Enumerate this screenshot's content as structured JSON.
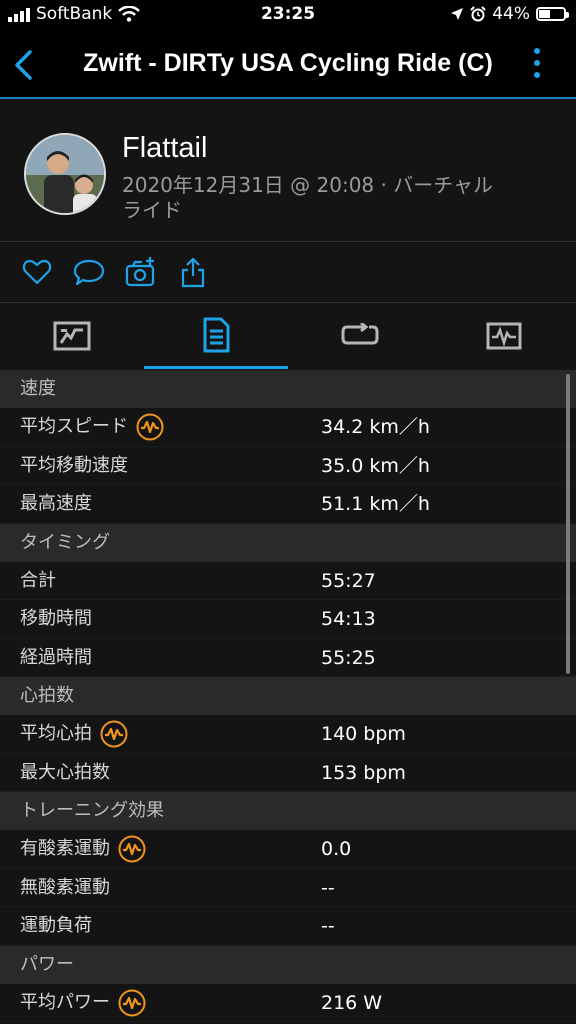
{
  "status_bar": {
    "carrier": "SoftBank",
    "time": "23:25",
    "battery_percent": "44%",
    "battery_level": 0.44,
    "icons": [
      "signal-icon",
      "wifi-icon",
      "location-icon",
      "alarm-icon",
      "battery-icon"
    ]
  },
  "nav": {
    "title": "Zwift - DIRTy USA Cycling Ride (C)",
    "icons": [
      "back-chevron-icon",
      "more-vertical-icon"
    ]
  },
  "profile": {
    "name": "Flattail",
    "meta_line1": "2020年12月31日 @ 20:08 · バーチャル",
    "meta_line2": "ライド"
  },
  "actions": [
    "like-icon",
    "comment-icon",
    "add-photo-icon",
    "share-icon"
  ],
  "tabs": [
    {
      "icon": "chart-tab-icon",
      "active": false
    },
    {
      "icon": "stats-tab-icon",
      "active": true
    },
    {
      "icon": "laps-tab-icon",
      "active": false
    },
    {
      "icon": "graph-tab-icon",
      "active": false
    }
  ],
  "sections": [
    {
      "header": "速度",
      "rows": [
        {
          "label": "平均スピード",
          "value": "34.2 km／h",
          "badge": true
        },
        {
          "label": "平均移動速度",
          "value": "35.0 km／h",
          "badge": false
        },
        {
          "label": "最高速度",
          "value": "51.1 km／h",
          "badge": false
        }
      ]
    },
    {
      "header": "タイミング",
      "rows": [
        {
          "label": "合計",
          "value": "55:27",
          "badge": false
        },
        {
          "label": "移動時間",
          "value": "54:13",
          "badge": false
        },
        {
          "label": "経過時間",
          "value": "55:25",
          "badge": false
        }
      ]
    },
    {
      "header": "心拍数",
      "rows": [
        {
          "label": "平均心拍",
          "value": "140 bpm",
          "badge": true
        },
        {
          "label": "最大心拍数",
          "value": "153 bpm",
          "badge": false
        }
      ]
    },
    {
      "header": "トレーニング効果",
      "rows": [
        {
          "label": "有酸素運動",
          "value": "0.0",
          "badge": true
        },
        {
          "label": "無酸素運動",
          "value": "--",
          "badge": false
        },
        {
          "label": "運動負荷",
          "value": "--",
          "badge": false
        }
      ]
    },
    {
      "header": "パワー",
      "rows": [
        {
          "label": "平均パワー",
          "value": "216 W",
          "badge": true
        }
      ]
    }
  ],
  "colors": {
    "accent": "#1fa3e8",
    "badge": "#f0951e",
    "background": "#141414",
    "section_header": "#2a2a2a"
  }
}
